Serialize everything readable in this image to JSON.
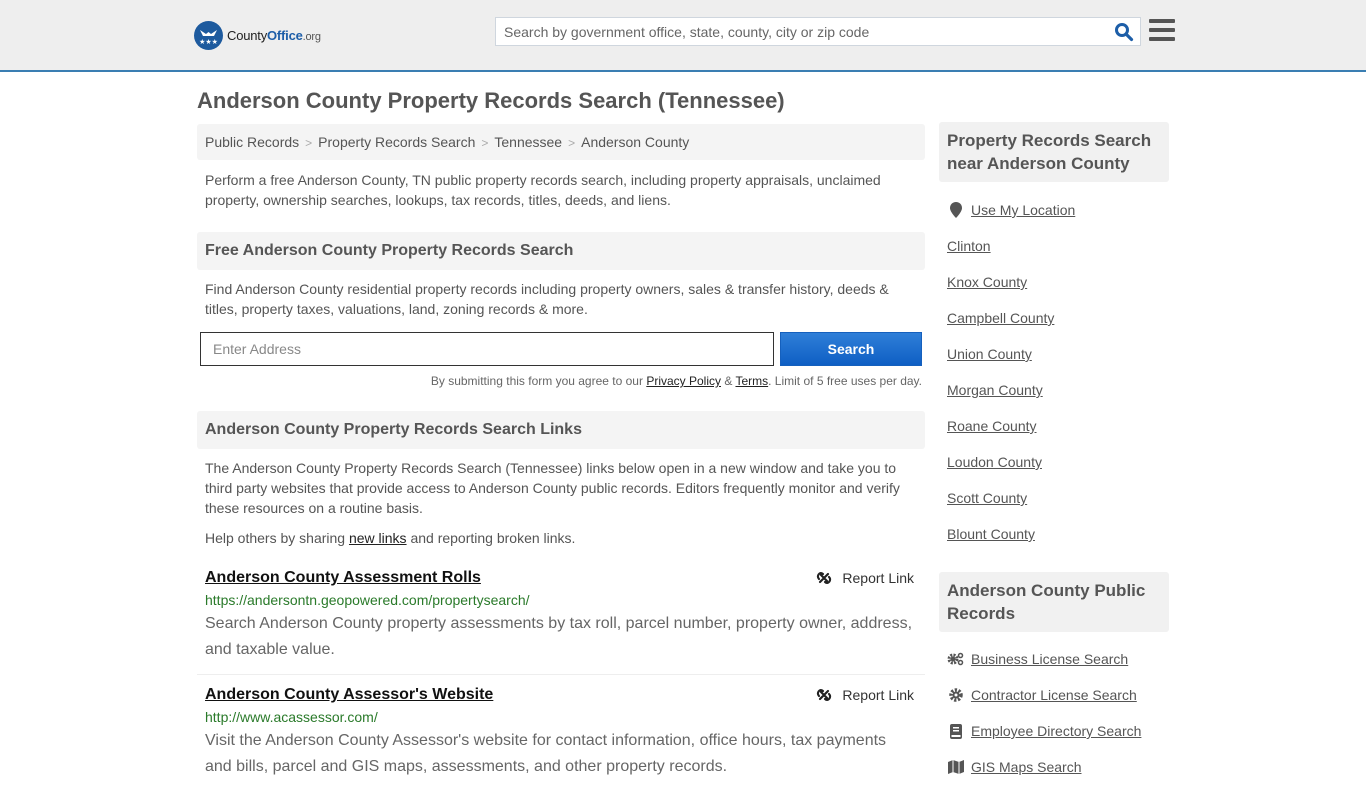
{
  "header": {
    "logo": {
      "county": "County",
      "office": "Office",
      "org": ".org"
    },
    "search_placeholder": "Search by government office, state, county, city or zip code"
  },
  "page_title": "Anderson County Property Records Search (Tennessee)",
  "breadcrumb": [
    "Public Records",
    "Property Records Search",
    "Tennessee",
    "Anderson County"
  ],
  "intro": "Perform a free Anderson County, TN public property records search, including property appraisals, unclaimed property, ownership searches, lookups, tax records, titles, deeds, and liens.",
  "free_search": {
    "heading": "Free Anderson County Property Records Search",
    "description": "Find Anderson County residential property records including property owners, sales & transfer history, deeds & titles, property taxes, valuations, land, zoning records & more.",
    "address_placeholder": "Enter Address",
    "button_label": "Search",
    "disclaimer_prefix": "By submitting this form you agree to our ",
    "privacy_label": "Privacy Policy",
    "amp": " & ",
    "terms_label": "Terms",
    "disclaimer_suffix": ". Limit of 5 free uses per day."
  },
  "links_section": {
    "heading": "Anderson County Property Records Search Links",
    "description": "The Anderson County Property Records Search (Tennessee) links below open in a new window and take you to third party websites that provide access to Anderson County public records. Editors frequently monitor and verify these resources on a routine basis.",
    "help_prefix": "Help others by sharing ",
    "help_link": "new links",
    "help_suffix": " and reporting broken links.",
    "report_label": "Report Link",
    "items": [
      {
        "title": "Anderson County Assessment Rolls",
        "url": "https://andersontn.geopowered.com/propertysearch/",
        "description": "Search Anderson County property assessments by tax roll, parcel number, property owner, address, and taxable value."
      },
      {
        "title": "Anderson County Assessor's Website",
        "url": "http://www.acassessor.com/",
        "description": "Visit the Anderson County Assessor's website for contact information, office hours, tax payments and bills, parcel and GIS maps, assessments, and other property records."
      }
    ]
  },
  "sidebar": {
    "nearby_heading": "Property Records Search near Anderson County",
    "use_location": "Use My Location",
    "nearby": [
      "Clinton",
      "Knox County",
      "Campbell County",
      "Union County",
      "Morgan County",
      "Roane County",
      "Loudon County",
      "Scott County",
      "Blount County"
    ],
    "public_heading": "Anderson County Public Records",
    "public_records": [
      {
        "label": "Business License Search",
        "icon": "gears-icon"
      },
      {
        "label": "Contractor License Search",
        "icon": "gear-icon"
      },
      {
        "label": "Employee Directory Search",
        "icon": "book-icon"
      },
      {
        "label": "GIS Maps Search",
        "icon": "map-icon"
      }
    ]
  }
}
